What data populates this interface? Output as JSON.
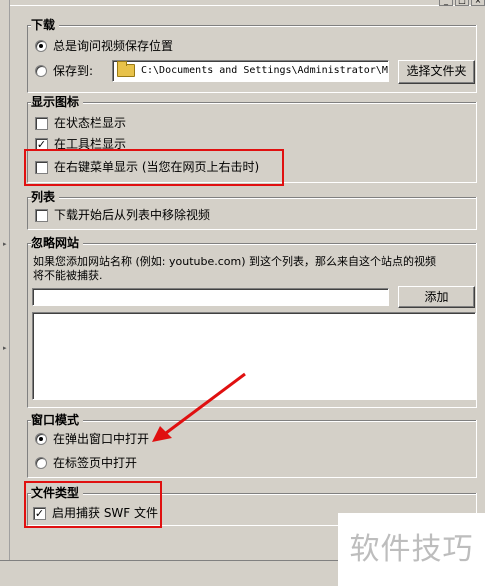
{
  "download": {
    "title": "下载",
    "ask_label": "总是询问视频保存位置",
    "save_to_label": "保存到:",
    "save_path": "C:\\Documents and Settings\\Administrator\\M",
    "choose_folder_button": "选择文件夹"
  },
  "display_icon": {
    "title": "显示图标",
    "statusbar_label": "在状态栏显示",
    "toolbar_label": "在工具栏显示",
    "context_menu_label": "在右键菜单显示 (当您在网页上右击时)"
  },
  "list": {
    "title": "列表",
    "remove_label": "下载开始后从列表中移除视频"
  },
  "ignore_sites": {
    "title": "忽略网站",
    "description_line1": "如果您添加网站名称 (例如: youtube.com) 到这个列表，那么来自这个站点的视频",
    "description_line2": "将不能被捕获.",
    "add_button": "添加",
    "site_input_value": ""
  },
  "window_mode": {
    "title": "窗口模式",
    "popup_label": "在弹出窗口中打开",
    "tab_label": "在标签页中打开"
  },
  "file_type": {
    "title": "文件类型",
    "swf_label": "启用捕获 SWF 文件"
  },
  "watermark": "软件技巧",
  "colors": {
    "highlight_red": "#e01010",
    "annotation_arrow": "#e01010"
  }
}
